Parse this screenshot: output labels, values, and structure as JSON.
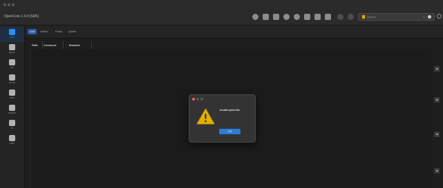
{
  "app": {
    "title": "OpenCore 1.0.4 [SDK]"
  },
  "toolbar": {
    "icons": [
      "search-icon",
      "list-icon",
      "window-icon",
      "history-icon",
      "transfer-icon",
      "grid-icon",
      "database-icon",
      "save-icon",
      "undo-icon",
      "redo-icon"
    ],
    "search": {
      "placeholder": "Search",
      "stepper": "↕"
    }
  },
  "sidebar": {
    "items": [
      {
        "label": "ACPI",
        "icon": "acpi-icon",
        "selected": true
      },
      {
        "label": "Booter",
        "icon": "booter-icon",
        "selected": false
      },
      {
        "label": "DP",
        "icon": "deviceproperties-icon",
        "selected": false
      },
      {
        "label": "Kernel",
        "icon": "kernel-icon",
        "selected": false
      },
      {
        "label": "Misc",
        "icon": "misc-icon",
        "selected": false
      },
      {
        "label": "NVRAM",
        "icon": "nvram-icon",
        "selected": false
      },
      {
        "label": "PI",
        "icon": "platforminfo-icon",
        "selected": false
      },
      {
        "label": "UEFI",
        "icon": "uefi-icon",
        "selected": false
      }
    ]
  },
  "tabs": [
    {
      "label": "Add",
      "selected": true
    },
    {
      "label": "Delete",
      "selected": false
    },
    {
      "label": "Patch",
      "selected": false
    },
    {
      "label": "Quirks",
      "selected": false
    }
  ],
  "table": {
    "columns": [
      "Path",
      "Comment",
      "Enabled"
    ]
  },
  "alert": {
    "message": "Invalid plist file.",
    "ok_label": "OK"
  },
  "colors": {
    "accent": "#2d7cd6",
    "warning": "#e1b000",
    "background": "#1e1e1e"
  }
}
